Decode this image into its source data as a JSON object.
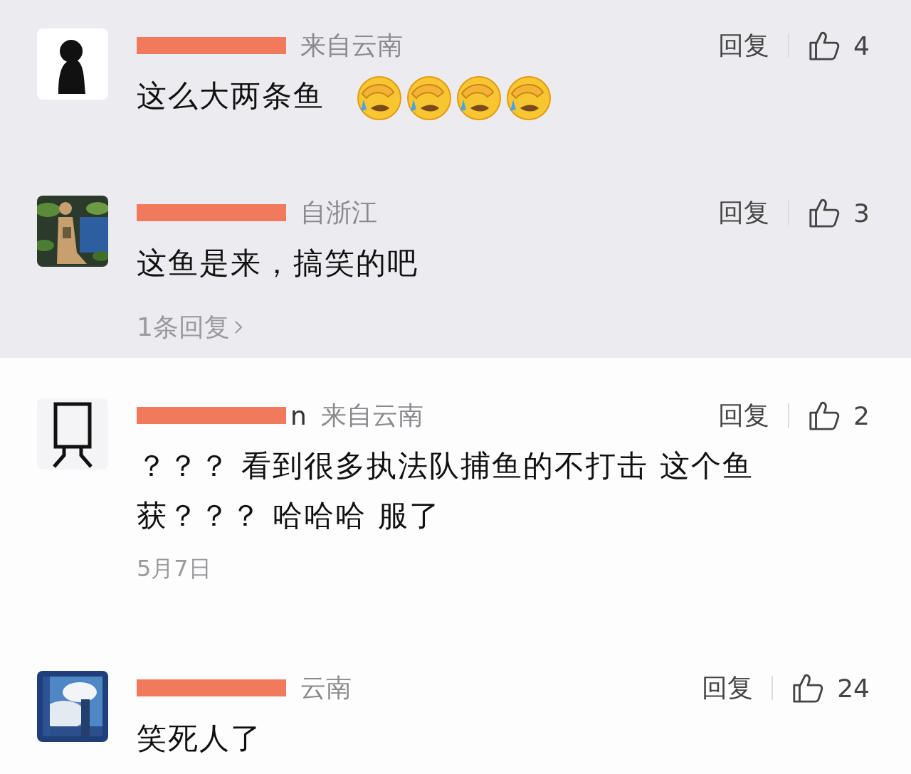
{
  "comments": [
    {
      "highlighted": true,
      "avatar": {
        "kind": "silhouette"
      },
      "location": "来自云南",
      "reply_label": "回复",
      "likes": "4",
      "text": "这么大两条鱼",
      "emojis": [
        {
          "kind": "facepalm"
        },
        {
          "kind": "facepalm"
        },
        {
          "kind": "facepalm"
        },
        {
          "kind": "facepalm"
        }
      ]
    },
    {
      "highlighted": true,
      "location": "自浙江",
      "reply_label": "回复",
      "likes": "3",
      "text": "这鱼是来，搞笑的吧",
      "replies_link": "1条回复"
    },
    {
      "highlighted": false,
      "avatar": {
        "kind": "doodle"
      },
      "name_visible": "n",
      "location": "来自云南",
      "reply_label": "回复",
      "likes": "2",
      "text": "？？？ 看到很多执法队捕鱼的不打击  这个鱼获？？？ 哈哈哈 服了",
      "date": "5月7日"
    },
    {
      "highlighted": false,
      "location": "云南",
      "reply_label": "回复",
      "likes": "24",
      "text": "笑死人了"
    }
  ]
}
